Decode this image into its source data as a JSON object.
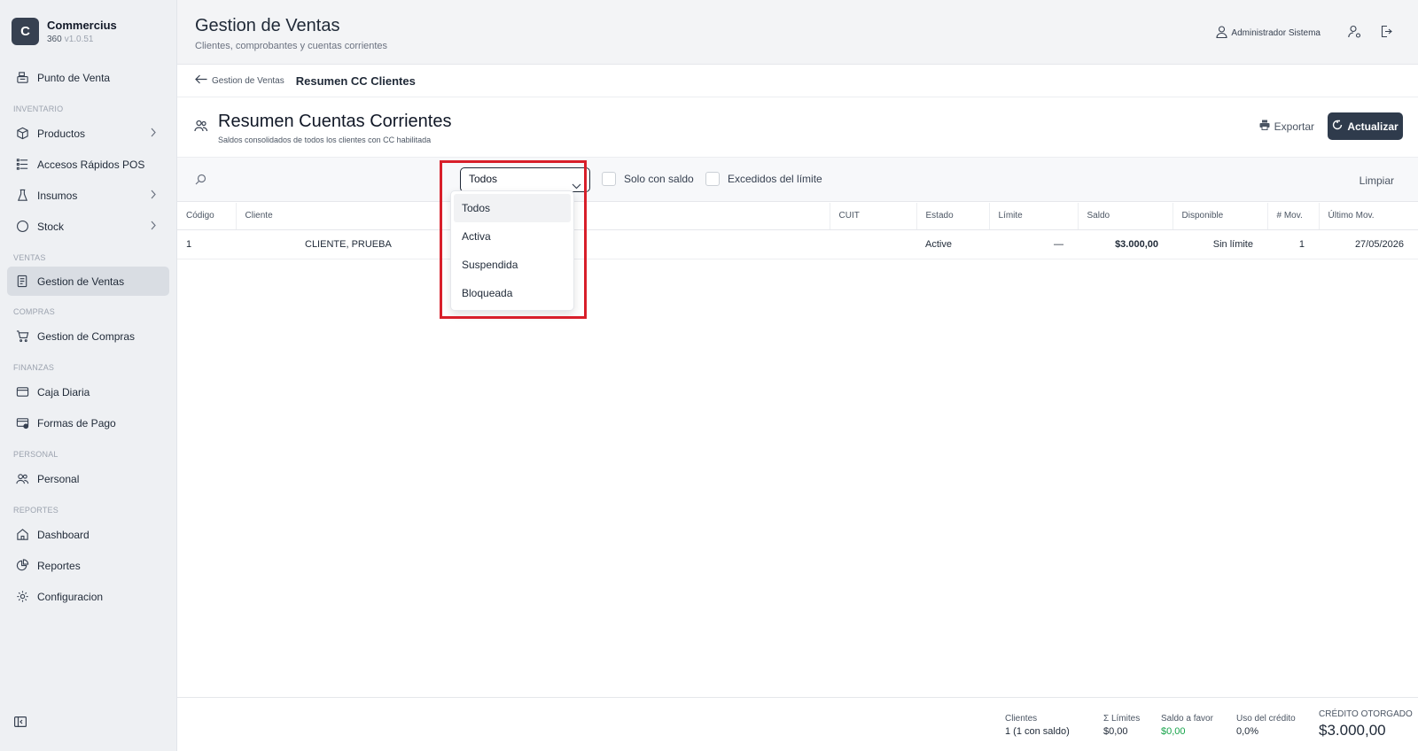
{
  "brand": {
    "logo_letter": "C",
    "name": "Commercius",
    "sub": "360",
    "version": "v1.0.51"
  },
  "sidebar": {
    "pos": "Punto de Venta",
    "sections": {
      "inventario": "INVENTARIO",
      "ventas": "VENTAS",
      "compras": "COMPRAS",
      "finanzas": "FINANZAS",
      "personal": "PERSONAL",
      "reportes": "REPORTES"
    },
    "items": {
      "productos": "Productos",
      "accesos": "Accesos Rápidos POS",
      "insumos": "Insumos",
      "stock": "Stock",
      "ventas": "Gestion de Ventas",
      "compras": "Gestion de Compras",
      "caja": "Caja Diaria",
      "formas": "Formas de Pago",
      "personal": "Personal",
      "dashboard": "Dashboard",
      "reportes": "Reportes",
      "config": "Configuracion"
    }
  },
  "header": {
    "title": "Gestion de Ventas",
    "subtitle": "Clientes, comprobantes y cuentas corrientes",
    "user": "Administrador Sistema"
  },
  "breadcrumb": {
    "back": "Gestion de Ventas",
    "current": "Resumen CC Clientes"
  },
  "page": {
    "title": "Resumen Cuentas Corrientes",
    "subtitle": "Saldos consolidados de todos los clientes con CC habilitada",
    "export": "Exportar",
    "refresh": "Actualizar"
  },
  "filters": {
    "estado_selected": "Todos",
    "options": [
      "Todos",
      "Activa",
      "Suspendida",
      "Bloqueada"
    ],
    "solo_saldo": "Solo con saldo",
    "excedidos": "Excedidos del límite",
    "clear": "Limpiar"
  },
  "table": {
    "columns": [
      "Código",
      "Cliente",
      "CUIT",
      "Estado",
      "Límite",
      "Saldo",
      "Disponible",
      "# Mov.",
      "Último Mov."
    ],
    "rows": [
      {
        "codigo": "1",
        "cliente": "CLIENTE, PRUEBA",
        "cuit": "",
        "estado": "Active",
        "limite": "—",
        "saldo": "$3.000,00",
        "disponible": "Sin límite",
        "mov": "1",
        "ultimo": "27/05/2026"
      }
    ]
  },
  "footer": {
    "clientes_label": "Clientes",
    "clientes_value": "1 (1 con saldo)",
    "limites_label": "Σ Límites",
    "limites_value": "$0,00",
    "favor_label": "Saldo a favor",
    "favor_value": "$0,00",
    "uso_label": "Uso del crédito",
    "uso_value": "0,0%",
    "credito_label": "CRÉDITO OTORGADO",
    "credito_value": "$3.000,00"
  },
  "colors": {
    "accent": "#2f3b4c",
    "highlight": "#d81f2a",
    "positive": "#16a34a"
  }
}
